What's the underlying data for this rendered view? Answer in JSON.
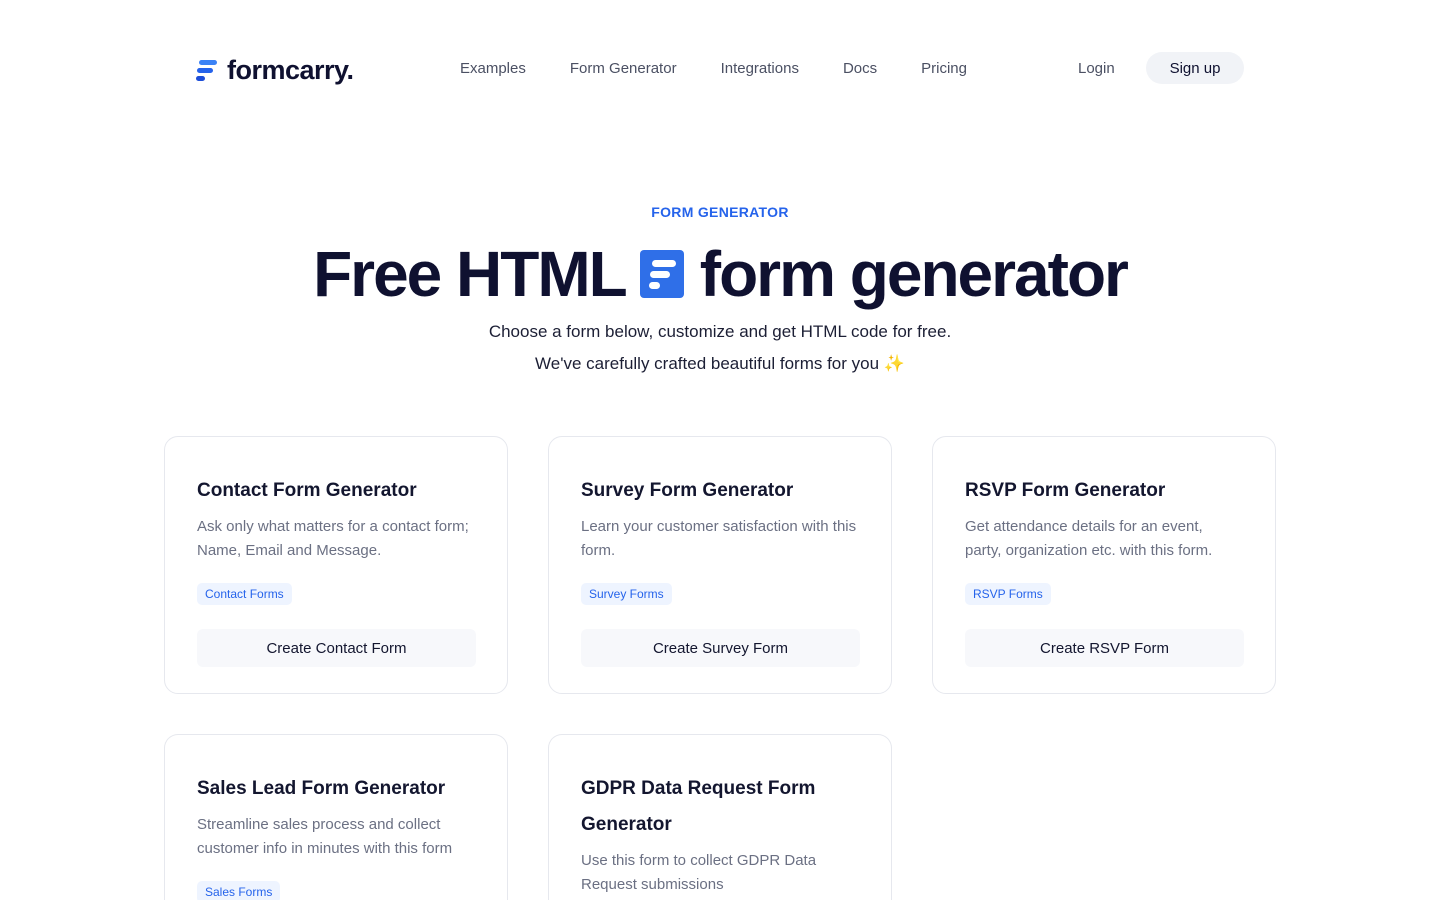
{
  "header": {
    "logo_text": "formcarry.",
    "nav": [
      "Examples",
      "Form Generator",
      "Integrations",
      "Docs",
      "Pricing"
    ],
    "login": "Login",
    "signup": "Sign up"
  },
  "hero": {
    "eyebrow": "FORM GENERATOR",
    "title_left": "Free HTML",
    "title_right": "form generator",
    "subtitle_1": "Choose a form below, customize and get HTML code for free.",
    "subtitle_2": "We've carefully crafted beautiful forms for you ✨"
  },
  "cards": [
    {
      "title": "Contact Form Generator",
      "description": "Ask only what matters for a contact form; Name, Email and Message.",
      "tag": "Contact Forms",
      "button": "Create Contact Form"
    },
    {
      "title": "Survey Form Generator",
      "description": "Learn your customer satisfaction with this form.",
      "tag": "Survey Forms",
      "button": "Create Survey Form"
    },
    {
      "title": "RSVP Form Generator",
      "description": "Get attendance details for an event, party, organization etc. with this form.",
      "tag": "RSVP Forms",
      "button": "Create RSVP Form"
    },
    {
      "title": "Sales Lead Form Generator",
      "description": "Streamline sales process and collect customer info in minutes with this form",
      "tag": "Sales Forms",
      "button": ""
    },
    {
      "title": "GDPR Data Request Form Generator",
      "description": "Use this form to collect GDPR Data Request submissions",
      "tag": "",
      "button": ""
    }
  ]
}
